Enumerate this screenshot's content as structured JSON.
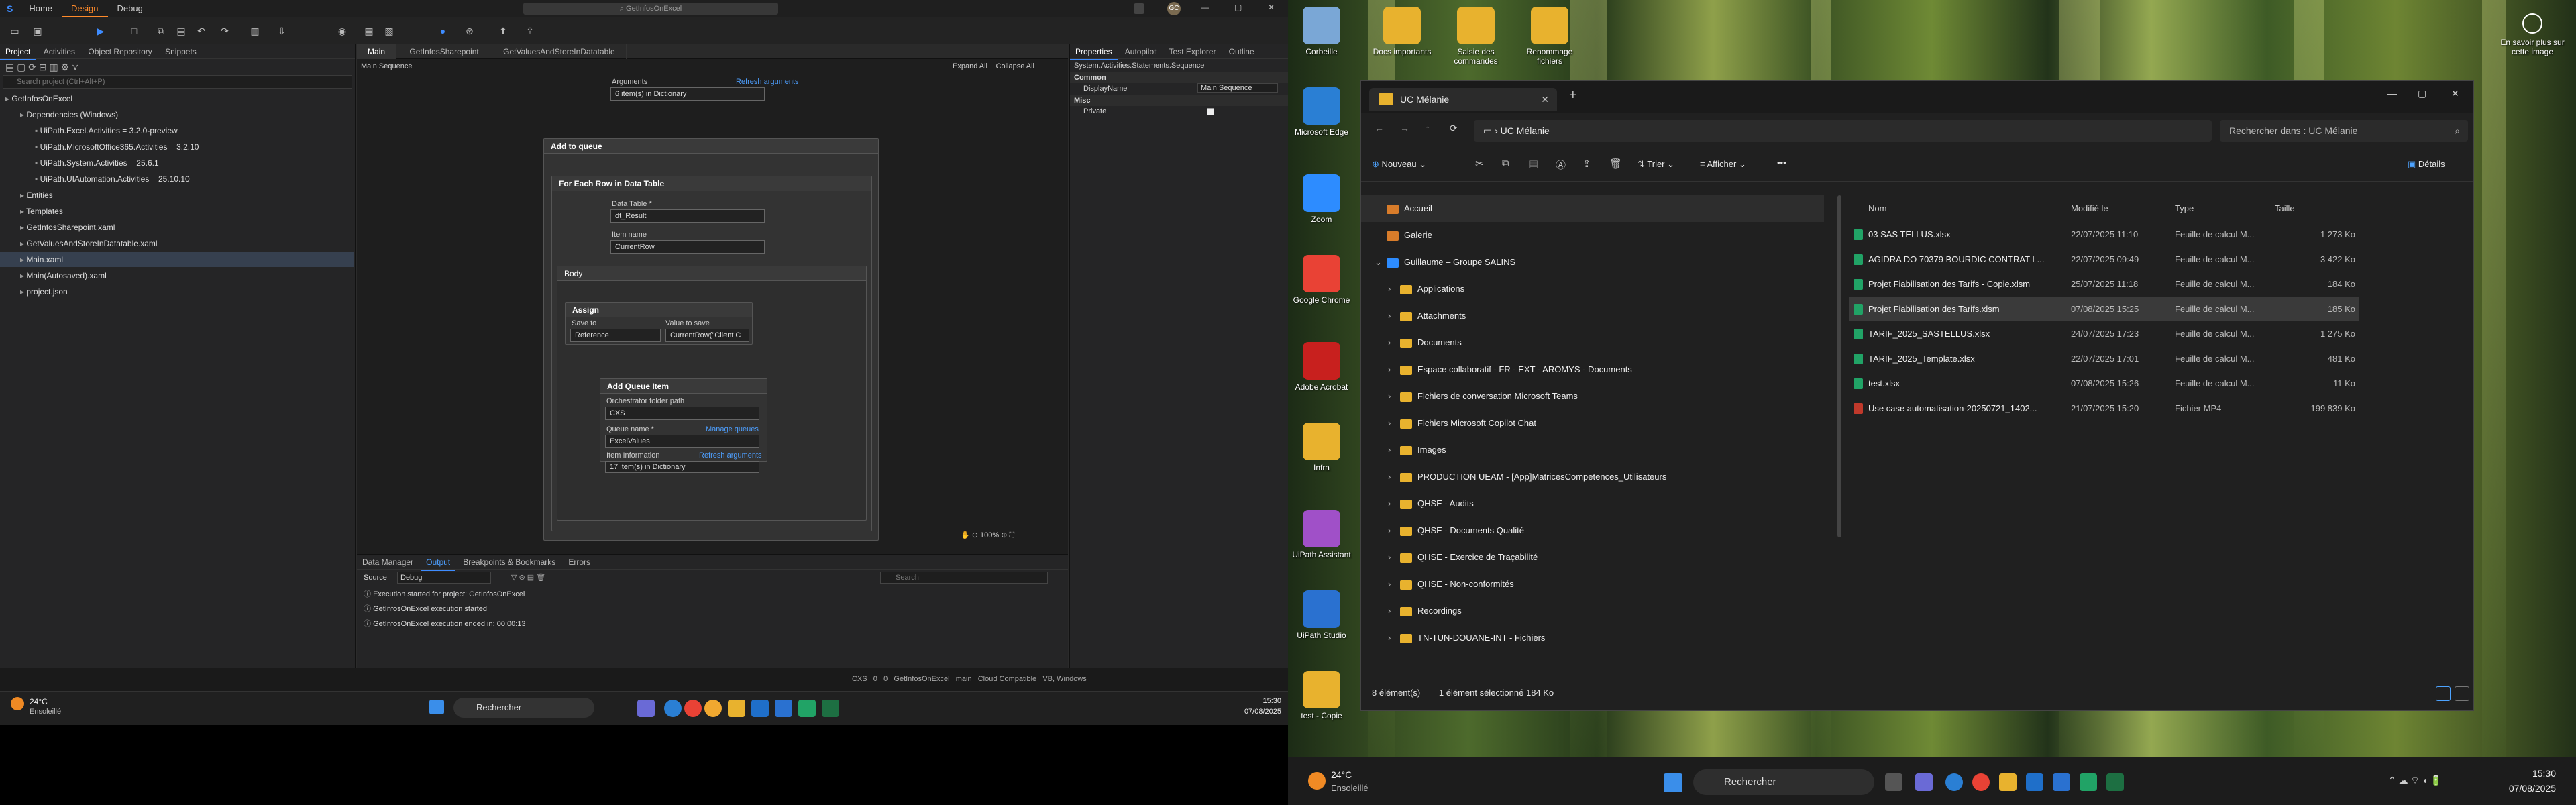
{
  "uipath": {
    "title": "GetInfosOnExcel",
    "menu": [
      "Home",
      "Design",
      "Debug"
    ],
    "active_menu": "Design",
    "project_tabs": [
      "Project",
      "Activities",
      "Object Repository",
      "Snippets"
    ],
    "search_project_placeholder": "Search project (Ctrl+Alt+P)",
    "tree": [
      {
        "label": "GetInfosOnExcel",
        "indent": 0
      },
      {
        "label": "Dependencies (Windows)",
        "indent": 1
      },
      {
        "label": "UiPath.Excel.Activities = 3.2.0-preview",
        "indent": 2
      },
      {
        "label": "UiPath.MicrosoftOffice365.Activities = 3.2.10",
        "indent": 2
      },
      {
        "label": "UiPath.System.Activities = 25.6.1",
        "indent": 2
      },
      {
        "label": "UiPath.UIAutomation.Activities = 25.10.10",
        "indent": 2
      },
      {
        "label": "Entities",
        "indent": 1
      },
      {
        "label": "Templates",
        "indent": 1
      },
      {
        "label": "GetInfosSharepoint.xaml",
        "indent": 1
      },
      {
        "label": "GetValuesAndStoreInDatatable.xaml",
        "indent": 1
      },
      {
        "label": "Main.xaml",
        "indent": 1
      },
      {
        "label": "Main(Autosaved).xaml",
        "indent": 1
      },
      {
        "label": "project.json",
        "indent": 1
      }
    ],
    "doc_tabs": [
      "Main",
      "GetInfosSharepoint",
      "GetValuesAndStoreInDatatable"
    ],
    "breadcrumb": "Main Sequence",
    "expand_all": "Expand All",
    "collapse_all": "Collapse All",
    "arguments_label": "Arguments",
    "refresh_arguments": "Refresh arguments",
    "arguments_value": "6 item(s) in Dictionary",
    "add_to_queue": "Add to queue",
    "for_each_row": "For Each Row in Data Table",
    "data_table_label": "Data Table *",
    "data_table_value": "dt_Result",
    "item_name_label": "Item name",
    "item_name_value": "CurrentRow",
    "body_label": "Body",
    "assign_label": "Assign",
    "save_to_label": "Save to",
    "value_to_save_label": "Value to save",
    "save_to_value": "Reference",
    "value_to_save_value": "CurrentRow(\"Client C",
    "add_queue_item": "Add Queue Item",
    "orch_folder_label": "Orchestrator folder path",
    "orch_folder_value": "CXS",
    "queue_name_label": "Queue name *",
    "manage_queues": "Manage queues",
    "queue_name_value": "ExcelValues",
    "item_info_label": "Item Information",
    "refresh_arguments_2": "Refresh arguments",
    "item_info_value": "17 item(s) in Dictionary",
    "zoom": "100%",
    "props_tabs": [
      "Properties",
      "Autopilot",
      "Test Explorer",
      "Outline"
    ],
    "props_path": "System.Activities.Statements.Sequence",
    "props_common": "Common",
    "props_display_name_label": "DisplayName",
    "props_display_name_value": "Main Sequence",
    "props_misc": "Misc",
    "props_private": "Private",
    "out_tabs": [
      "Data Manager",
      "Output",
      "Breakpoints & Bookmarks",
      "Errors"
    ],
    "source_label": "Source",
    "source_value": "Debug",
    "out_search_placeholder": "Search",
    "output_lines": [
      "Execution started for project: GetInfosOnExcel",
      "GetInfosOnExcel execution started",
      "GetInfosOnExcel execution ended in: 00:00:13"
    ],
    "status": [
      "CXS",
      "0",
      "0",
      "GetInfosOnExcel",
      "main",
      "Cloud Compatible",
      "VB, Windows"
    ]
  },
  "taskbar_left": {
    "weather_temp": "24°C",
    "weather_text": "Ensoleillé",
    "search_label": "Rechercher",
    "time": "15:30",
    "date": "07/08/2025"
  },
  "taskbar_right": {
    "weather_temp": "24°C",
    "weather_text": "Ensoleillé",
    "search_label": "Rechercher",
    "time": "15:30",
    "date": "07/08/2025"
  },
  "desktop_icons": [
    "Corbeille",
    "Docs importants",
    "Saisie des commandes",
    "Renommage fichiers",
    "Microsoft Edge",
    "Zoom",
    "Google Chrome",
    "Adobe Acrobat",
    "Infra",
    "UiPath Assistant",
    "UiPath Studio",
    "test - Copie"
  ],
  "desktop_notice": "En savoir plus sur cette image",
  "explorer": {
    "tab_title": "UC Mélanie",
    "path_label": "UC Mélanie",
    "search_placeholder": "Rechercher dans : UC Mélanie",
    "new_label": "Nouveau",
    "sort_label": "Trier",
    "view_label": "Afficher",
    "details_label": "Détails",
    "nav": [
      {
        "label": "Accueil",
        "indent": 0,
        "sel": true
      },
      {
        "label": "Galerie",
        "indent": 0
      },
      {
        "label": "Guillaume – Groupe SALINS",
        "indent": 0,
        "expand": true
      },
      {
        "label": "Applications",
        "indent": 1
      },
      {
        "label": "Attachments",
        "indent": 1
      },
      {
        "label": "Documents",
        "indent": 1
      },
      {
        "label": "Espace collaboratif - FR - EXT - AROMYS - Documents",
        "indent": 1
      },
      {
        "label": "Fichiers de conversation Microsoft Teams",
        "indent": 1
      },
      {
        "label": "Fichiers Microsoft Copilot Chat",
        "indent": 1
      },
      {
        "label": "Images",
        "indent": 1
      },
      {
        "label": "PRODUCTION UEAM - [App]MatricesCompetences_Utilisateurs",
        "indent": 1
      },
      {
        "label": "QHSE - Audits",
        "indent": 1
      },
      {
        "label": "QHSE - Documents Qualité",
        "indent": 1
      },
      {
        "label": "QHSE - Exercice de Traçabilité",
        "indent": 1
      },
      {
        "label": "QHSE - Non-conformités",
        "indent": 1
      },
      {
        "label": "Recordings",
        "indent": 1
      },
      {
        "label": "TN-TUN-DOUANE-INT - Fichiers",
        "indent": 1
      }
    ],
    "columns": [
      "Nom",
      "Modifié le",
      "Type",
      "Taille"
    ],
    "files": [
      {
        "name": "03 SAS TELLUS.xlsx",
        "date": "22/07/2025 11:10",
        "type": "Feuille de calcul M...",
        "size": "1 273 Ko"
      },
      {
        "name": "AGIDRA DO 70379 BOURDIC CONTRAT L...",
        "date": "22/07/2025 09:49",
        "type": "Feuille de calcul M...",
        "size": "3 422 Ko"
      },
      {
        "name": "Projet Fiabilisation des Tarifs - Copie.xlsm",
        "date": "25/07/2025 11:18",
        "type": "Feuille de calcul M...",
        "size": "184 Ko"
      },
      {
        "name": "Projet Fiabilisation des Tarifs.xlsm",
        "date": "07/08/2025 15:25",
        "type": "Feuille de calcul M...",
        "size": "185 Ko",
        "sel": true
      },
      {
        "name": "TARIF_2025_SASTELLUS.xlsx",
        "date": "24/07/2025 17:23",
        "type": "Feuille de calcul M...",
        "size": "1 275 Ko"
      },
      {
        "name": "TARIF_2025_Template.xlsx",
        "date": "22/07/2025 17:01",
        "type": "Feuille de calcul M...",
        "size": "481 Ko"
      },
      {
        "name": "test.xlsx",
        "date": "07/08/2025 15:26",
        "type": "Feuille de calcul M...",
        "size": "11 Ko"
      },
      {
        "name": "Use case automatisation-20250721_1402...",
        "date": "21/07/2025 15:20",
        "type": "Fichier MP4",
        "size": "199 839 Ko"
      }
    ],
    "status_count": "8 élément(s)",
    "status_selected": "1 élément sélectionné  184 Ko"
  }
}
